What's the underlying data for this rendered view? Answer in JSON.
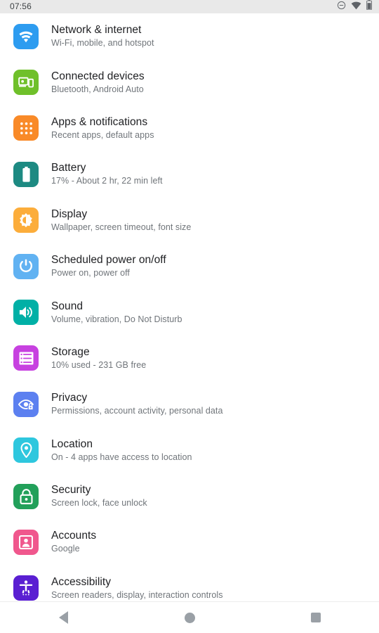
{
  "status_bar": {
    "clock": "07:56",
    "icons": [
      {
        "name": "do-not-disturb-icon",
        "glyph": "circle-minus"
      },
      {
        "name": "wifi-icon",
        "glyph": "wifi"
      },
      {
        "name": "battery-icon",
        "glyph": "battery"
      }
    ]
  },
  "settings": {
    "items": [
      {
        "key": "network-internet",
        "title": "Network & internet",
        "subtitle": "Wi-Fi, mobile, and hotspot",
        "icon": "wifi-icon",
        "color": "#2d9cf0"
      },
      {
        "key": "connected-devices",
        "title": "Connected devices",
        "subtitle": "Bluetooth, Android Auto",
        "icon": "devices-icon",
        "color": "#6fc02a"
      },
      {
        "key": "apps-notifications",
        "title": "Apps & notifications",
        "subtitle": "Recent apps, default apps",
        "icon": "apps-grid-icon",
        "color": "#f98a28"
      },
      {
        "key": "battery",
        "title": "Battery",
        "subtitle": "17% - About 2 hr, 22 min left",
        "icon": "battery-icon",
        "color": "#1d8a82"
      },
      {
        "key": "display",
        "title": "Display",
        "subtitle": "Wallpaper, screen timeout, font size",
        "icon": "brightness-icon",
        "color": "#fcad3b"
      },
      {
        "key": "scheduled-power",
        "title": "Scheduled power on/off",
        "subtitle": "Power on, power off",
        "icon": "power-icon",
        "color": "#61b2f2"
      },
      {
        "key": "sound",
        "title": "Sound",
        "subtitle": "Volume, vibration, Do Not Disturb",
        "icon": "speaker-icon",
        "color": "#00b0a6"
      },
      {
        "key": "storage",
        "title": "Storage",
        "subtitle": "10% used - 231 GB free",
        "icon": "storage-list-icon",
        "color": "#c741e0"
      },
      {
        "key": "privacy",
        "title": "Privacy",
        "subtitle": "Permissions, account activity, personal data",
        "icon": "eye-lock-icon",
        "color": "#5c80f0"
      },
      {
        "key": "location",
        "title": "Location",
        "subtitle": "On - 4 apps have access to location",
        "icon": "location-pin-icon",
        "color": "#2ec7de"
      },
      {
        "key": "security",
        "title": "Security",
        "subtitle": "Screen lock, face unlock",
        "icon": "lock-icon",
        "color": "#22a05a"
      },
      {
        "key": "accounts",
        "title": "Accounts",
        "subtitle": "Google",
        "icon": "account-card-icon",
        "color": "#f0578d"
      },
      {
        "key": "accessibility",
        "title": "Accessibility",
        "subtitle": "Screen readers, display, interaction controls",
        "icon": "accessibility-icon",
        "color": "#5a1fd2"
      }
    ]
  },
  "nav_bar": {
    "back_label": "Back",
    "home_label": "Home",
    "recents_label": "Recent apps"
  }
}
